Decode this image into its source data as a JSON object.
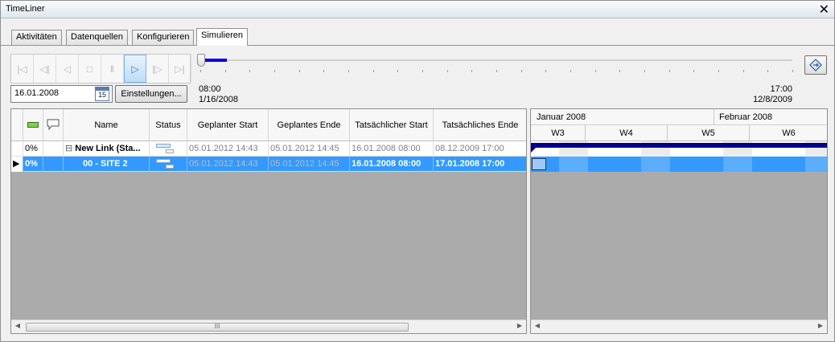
{
  "window": {
    "title": "TimeLiner",
    "close_glyph": "✕"
  },
  "tabs": [
    {
      "label": "Aktivitäten",
      "active": false
    },
    {
      "label": "Datenquellen",
      "active": false
    },
    {
      "label": "Konfigurieren",
      "active": false
    },
    {
      "label": "Simulieren",
      "active": true
    }
  ],
  "toolbar": {
    "buttons": [
      {
        "name": "go-to-start-icon",
        "glyph": "|◁",
        "active": false
      },
      {
        "name": "step-back-icon",
        "glyph": "◁|",
        "active": false
      },
      {
        "name": "play-reverse-icon",
        "glyph": "◁",
        "active": false
      },
      {
        "name": "stop-icon",
        "glyph": "□",
        "active": false
      },
      {
        "name": "pause-icon",
        "glyph": "‖",
        "active": false
      },
      {
        "name": "play-icon",
        "glyph": "▷",
        "active": true
      },
      {
        "name": "step-forward-icon",
        "glyph": "|▷",
        "active": false
      },
      {
        "name": "go-to-end-icon",
        "glyph": "▷|",
        "active": false
      }
    ]
  },
  "date_input": {
    "value": "16.01.2008",
    "calendar_day": "15"
  },
  "settings_button": {
    "label": "Einstellungen..."
  },
  "slider": {
    "progress": 0.045
  },
  "time_start": {
    "time": "08:00",
    "date": "1/16/2008"
  },
  "time_end": {
    "time": "17:00",
    "date": "12/8/2009"
  },
  "grid": {
    "columns": [
      "",
      "",
      "Name",
      "Status",
      "Geplanter Start",
      "Geplantes Ende",
      "Tatsächlicher Start",
      "Tatsächliches Ende"
    ],
    "rows": [
      {
        "indicator": "",
        "progress": "0%",
        "expander": "⊟",
        "name": "New Link (Sta...",
        "planned_start": "05.01.2012 14:43",
        "planned_end": "05.01.2012 14:45",
        "actual_start": "16.01.2008 08:00",
        "actual_end": "08.12.2009 17:00",
        "selected": false
      },
      {
        "indicator": "▶",
        "progress": "0%",
        "expander": "",
        "name": "00 - SITE 2",
        "planned_start": "05.01.2012 14:43",
        "planned_end": "05.01.2012 14:45",
        "actual_start": "16.01.2008 08:00",
        "actual_end": "17.01.2008 17:00",
        "selected": true
      }
    ],
    "scroll_grip": "III"
  },
  "gantt": {
    "months": [
      "Januar 2008",
      "Februar 2008"
    ],
    "weeks": [
      "W3",
      "W4",
      "W5",
      "W6"
    ]
  },
  "colors": {
    "selection": "#3399ff",
    "summary_bar": "#00008b",
    "slider_fill": "#0000ee"
  }
}
